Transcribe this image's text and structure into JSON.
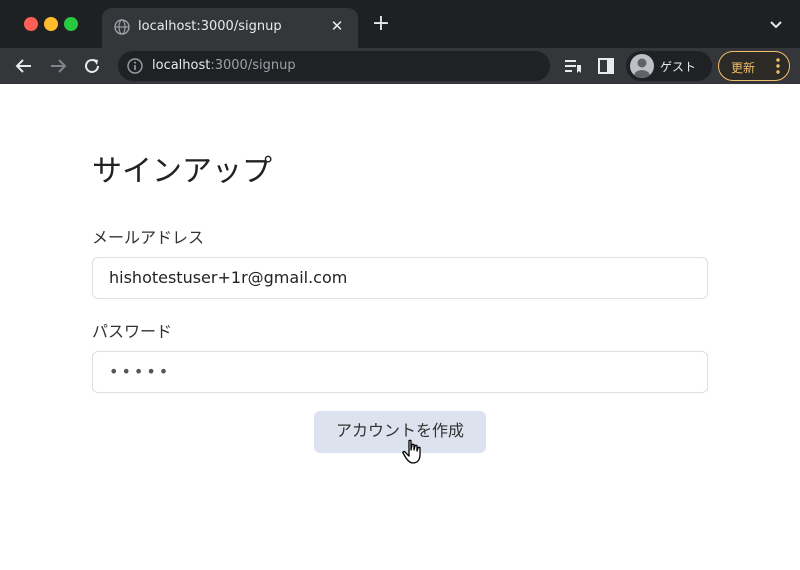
{
  "browser": {
    "tab_title": "localhost:3000/signup",
    "url_host": "localhost",
    "url_rest": ":3000/signup",
    "profile_label": "ゲスト",
    "update_label": "更新",
    "accent": "#f2be6a"
  },
  "page": {
    "title": "サインアップ",
    "email_label": "メールアドレス",
    "email_value": "hishotestuser+1r@gmail.com",
    "password_label": "パスワード",
    "password_value": "•••••",
    "submit_label": "アカウントを作成"
  },
  "icons": {
    "tab": [
      "globe-icon",
      "close-icon",
      "plus-icon",
      "chevron-down-icon"
    ],
    "toolbar": [
      "back-icon",
      "forward-icon",
      "reload-icon",
      "site-info-icon",
      "reading-list-icon",
      "side-panel-icon",
      "avatar-icon",
      "kebab-icon"
    ],
    "page": [
      "hand-cursor-icon"
    ]
  }
}
